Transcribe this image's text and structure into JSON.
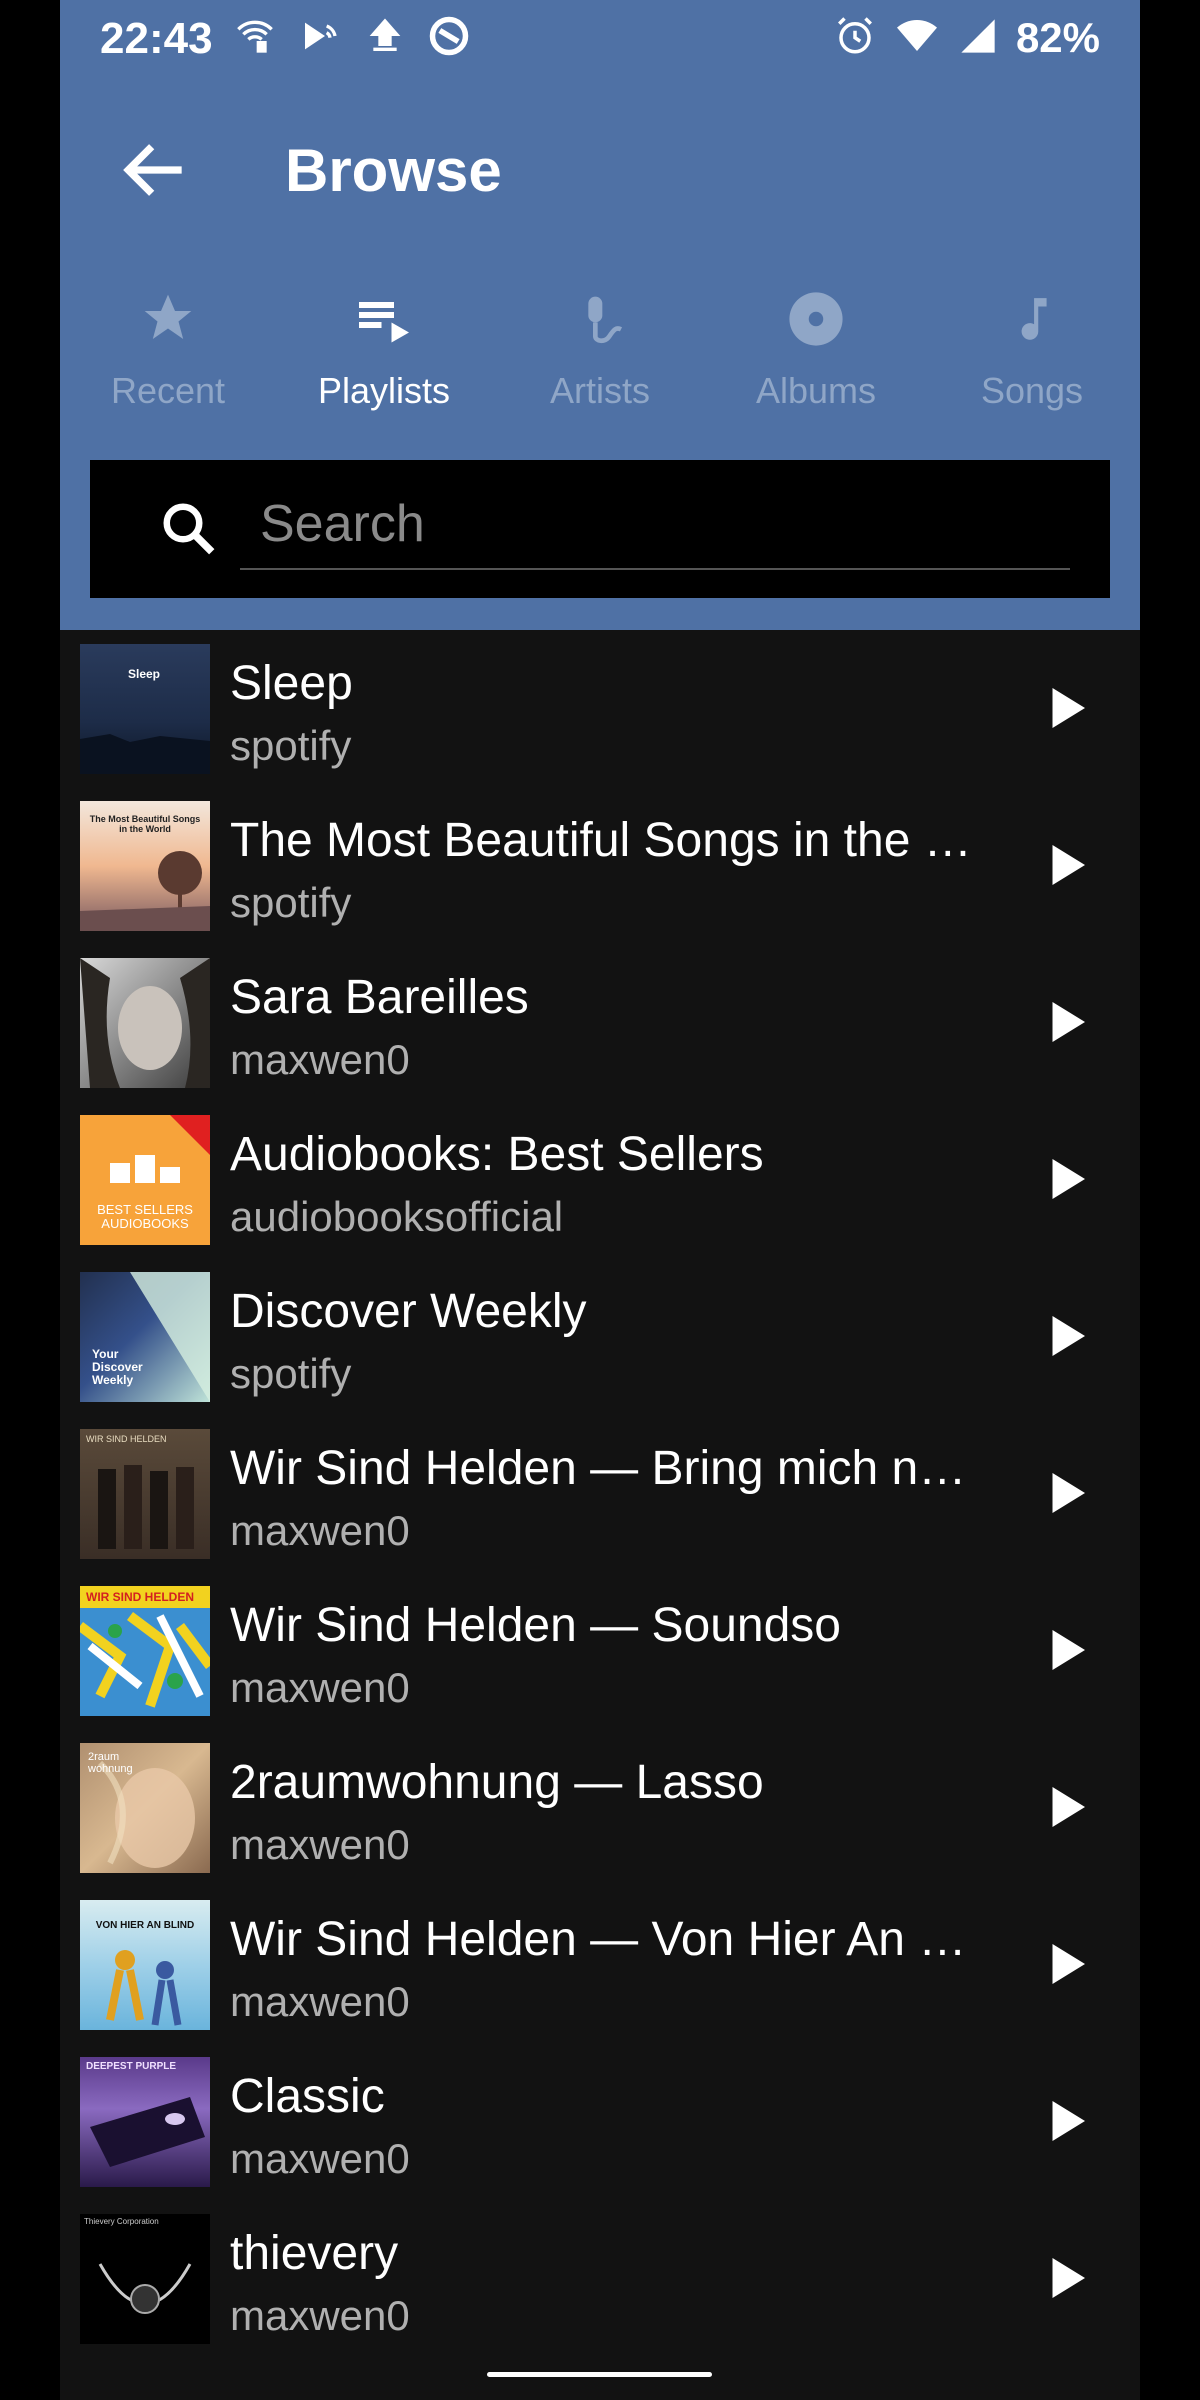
{
  "status": {
    "time": "22:43",
    "battery": "82%"
  },
  "header": {
    "title": "Browse"
  },
  "tabs": [
    {
      "label": "Recent",
      "icon": "star-icon",
      "active": false
    },
    {
      "label": "Playlists",
      "icon": "playlist-icon",
      "active": true
    },
    {
      "label": "Artists",
      "icon": "microphone-icon",
      "active": false
    },
    {
      "label": "Albums",
      "icon": "disc-icon",
      "active": false
    },
    {
      "label": "Songs",
      "icon": "music-note-icon",
      "active": false
    }
  ],
  "search": {
    "placeholder": "Search",
    "value": ""
  },
  "playlists": [
    {
      "title": "Sleep",
      "owner": "spotify",
      "cover_text": "Sleep"
    },
    {
      "title": "The Most Beautiful Songs in the World",
      "owner": "spotify",
      "cover_text": "The Most Beautiful Songs in the World"
    },
    {
      "title": "Sara Bareilles",
      "owner": "maxwen0",
      "cover_text": ""
    },
    {
      "title": "Audiobooks: Best Sellers",
      "owner": "audiobooksofficial",
      "cover_text": "BEST SELLERS AUDIOBOOKS"
    },
    {
      "title": "Discover Weekly",
      "owner": "spotify",
      "cover_text": "Your Discover Weekly"
    },
    {
      "title": "Wir Sind Helden — Bring mich nach Hause",
      "owner": "maxwen0",
      "cover_text": "WIR SIND HELDEN"
    },
    {
      "title": "Wir Sind Helden — Soundso",
      "owner": "maxwen0",
      "cover_text": "WIR SIND HELDEN"
    },
    {
      "title": "2raumwohnung — Lasso",
      "owner": "maxwen0",
      "cover_text": "2raum wohnung"
    },
    {
      "title": "Wir Sind Helden — Von Hier An Blind",
      "owner": "maxwen0",
      "cover_text": "VON HIER AN BLIND"
    },
    {
      "title": "Classic",
      "owner": "maxwen0",
      "cover_text": "DEEPEST PURPLE"
    },
    {
      "title": "thievery",
      "owner": "maxwen0",
      "cover_text": "Thievery Corporation"
    }
  ]
}
